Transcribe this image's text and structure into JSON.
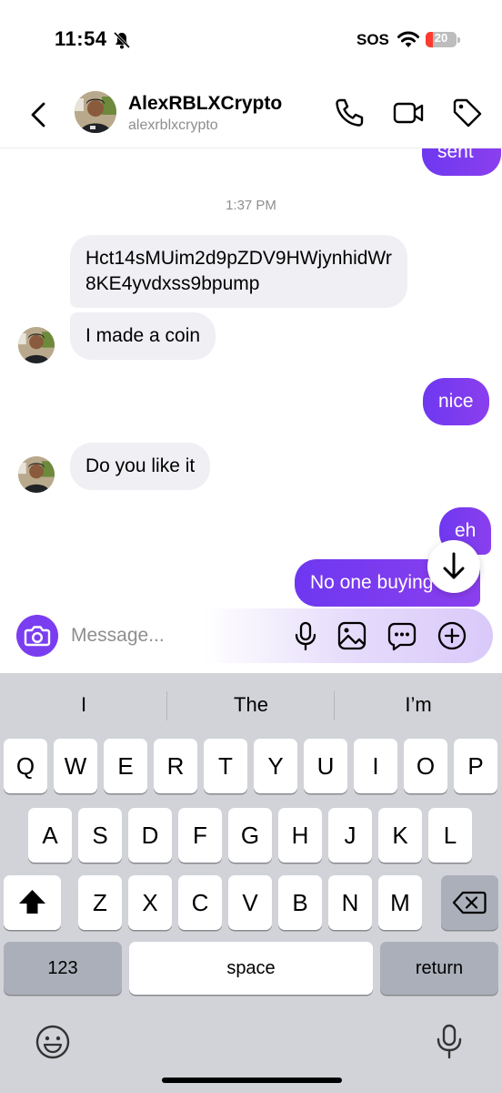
{
  "status_bar": {
    "time": "11:54",
    "sos": "SOS",
    "battery": "20"
  },
  "header": {
    "name": "AlexRBLXCrypto",
    "handle": "alexrblxcrypto"
  },
  "chat": {
    "top_partial_bubble": "sent",
    "timestamp": "1:37 PM",
    "messages": [
      {
        "side": "in",
        "text_line1": "Hct14sMUim2d9pZDV9HWjynhidWr",
        "text_line2": "8KE4yvdxss9bpump"
      },
      {
        "side": "in",
        "text": "I made a coin"
      },
      {
        "side": "out",
        "text": "nice"
      },
      {
        "side": "in",
        "text": "Do you like it"
      },
      {
        "side": "out",
        "text": "eh"
      },
      {
        "side": "out",
        "text": "No one buying tbh"
      }
    ]
  },
  "composer": {
    "placeholder": "Message..."
  },
  "keyboard": {
    "suggestions": [
      "I",
      "The",
      "I’m"
    ],
    "row1": [
      "Q",
      "W",
      "E",
      "R",
      "T",
      "Y",
      "U",
      "I",
      "O",
      "P"
    ],
    "row2": [
      "A",
      "S",
      "D",
      "F",
      "G",
      "H",
      "J",
      "K",
      "L"
    ],
    "row3": [
      "Z",
      "X",
      "C",
      "V",
      "B",
      "N",
      "M"
    ],
    "numbers_label": "123",
    "space_label": "space",
    "return_label": "return"
  },
  "colors": {
    "accent": "#7b3df0",
    "incoming_bubble": "#efeff4",
    "keyboard_bg": "#d1d3d9"
  },
  "icons": [
    "back-icon",
    "phone-icon",
    "video-icon",
    "tag-icon",
    "camera-icon",
    "mic-icon",
    "gallery-icon",
    "sticker-icon",
    "plus-icon",
    "shift-icon",
    "backspace-icon",
    "emoji-icon",
    "dictation-icon",
    "arrow-down-icon"
  ]
}
